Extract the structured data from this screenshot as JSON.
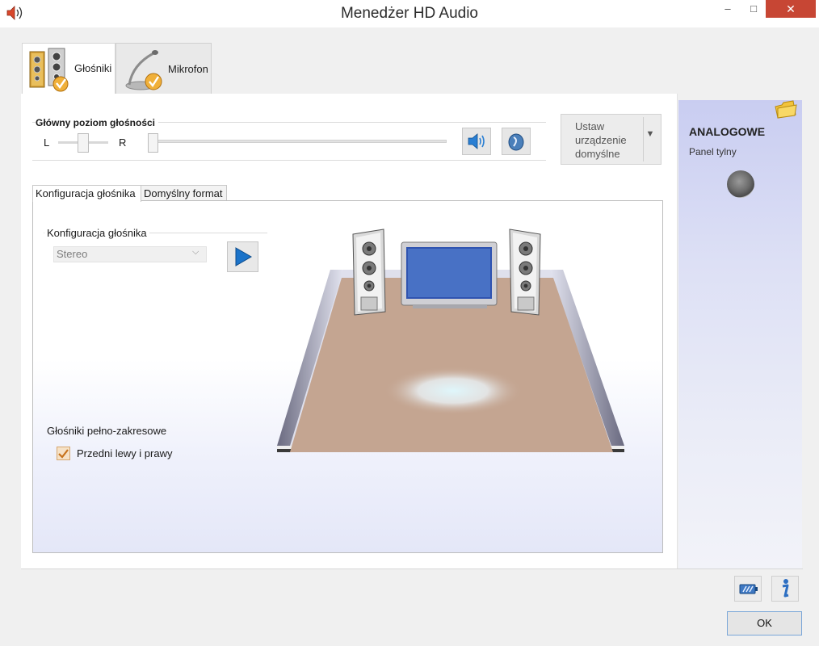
{
  "window": {
    "title": "Menedżer HD Audio",
    "minimize_glyph": "–",
    "maximize_glyph": "□",
    "close_glyph": "✕"
  },
  "device_tabs": [
    {
      "label": "Głośniki",
      "icon": "speakers-icon",
      "active": true
    },
    {
      "label": "Mikrofon",
      "icon": "microphone-icon",
      "active": false
    }
  ],
  "volume": {
    "label": "Główny poziom głośności",
    "left_label": "L",
    "right_label": "R",
    "balance": 0.5,
    "level": 0.0
  },
  "default_device": {
    "label": "Ustaw urządzenie domyślne",
    "dropdown_glyph": "▼"
  },
  "sub_tabs": [
    {
      "label": "Konfiguracja głośnika",
      "active": true
    },
    {
      "label": "Domyślny format",
      "active": false
    }
  ],
  "speaker_config": {
    "label": "Konfiguracja głośnika",
    "selected": "Stereo",
    "select_arrow": "⌵",
    "full_range_label": "Głośniki pełno-zakresowe",
    "checkbox_label": "Przedni lewy i prawy",
    "checkbox_checked": true,
    "checkbox_glyph": "✓"
  },
  "analog": {
    "title": "ANALOGOWE",
    "subtitle": "Panel tylny"
  },
  "ok_label": "OK",
  "colors": {
    "close_button": "#c74634",
    "floor": "#c4a591",
    "analog_panel": "#c9cdf1",
    "play_arrow": "#1b73c9"
  }
}
